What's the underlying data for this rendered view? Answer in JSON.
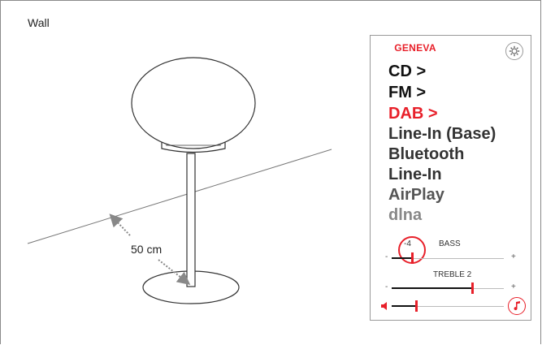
{
  "scene": {
    "wall_label": "Wall",
    "distance_label": "50 cm"
  },
  "panel": {
    "brand": "GENEVA",
    "sources": [
      {
        "label": "CD >",
        "color": "#111111"
      },
      {
        "label": "FM >",
        "color": "#111111"
      },
      {
        "label": "DAB >",
        "color": "#e8202a"
      },
      {
        "label": "Line-In (Base)",
        "color": "#333333"
      },
      {
        "label": "Bluetooth",
        "color": "#333333"
      },
      {
        "label": "Line-In",
        "color": "#333333"
      },
      {
        "label": "AirPlay",
        "color": "#555555"
      },
      {
        "label": "dlna",
        "color": "#888888"
      }
    ],
    "bass": {
      "label": "BASS",
      "value": "-4",
      "level": 0.18,
      "minus": "-",
      "plus": "+"
    },
    "treble": {
      "label": "TREBLE 2",
      "level": 0.72,
      "minus": "-",
      "plus": "+"
    },
    "volume": {
      "level": 0.22
    },
    "icons": {
      "settings": "gear-icon",
      "volume": "speaker-icon",
      "music": "music-note-icon"
    },
    "accent_color": "#e8202a"
  }
}
